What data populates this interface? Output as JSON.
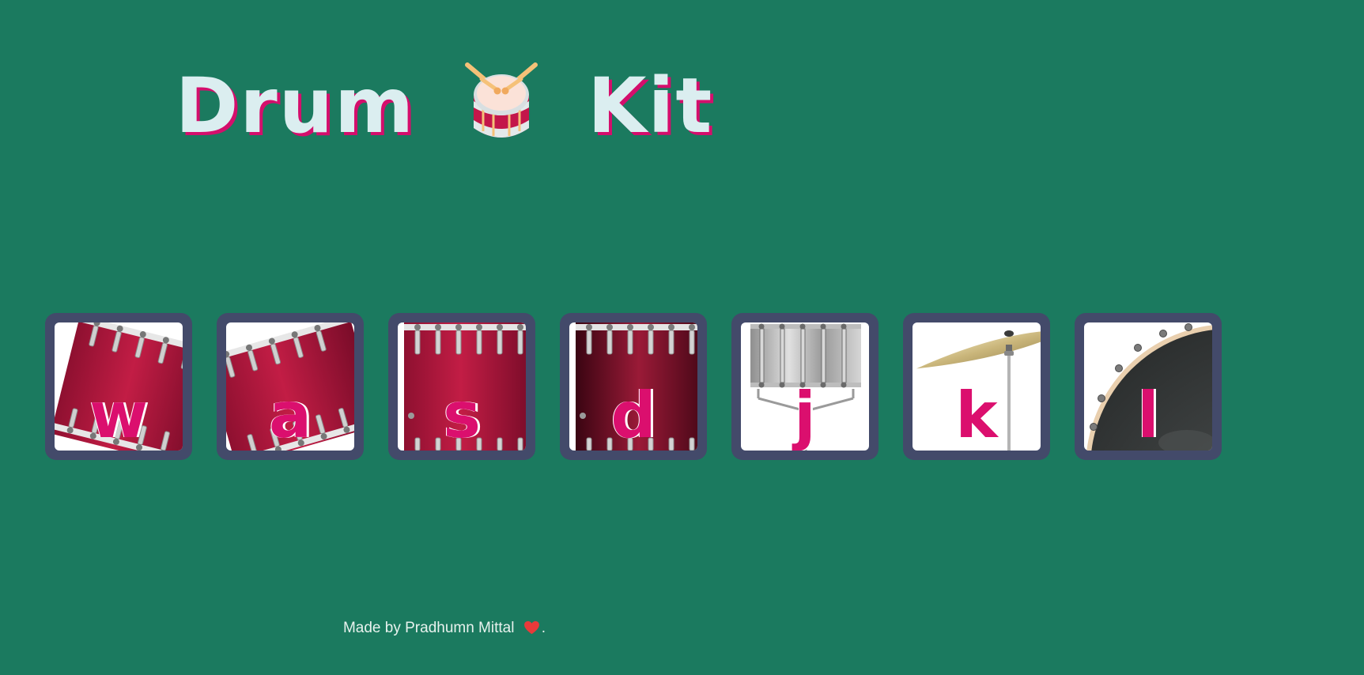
{
  "page": {
    "title_left": "Drum",
    "title_right": "Kit",
    "title_icon": "drum-with-sticks-icon"
  },
  "drums": [
    {
      "key": "w",
      "instrument_icon": "tom-drum-icon"
    },
    {
      "key": "a",
      "instrument_icon": "tom-drum-icon"
    },
    {
      "key": "s",
      "instrument_icon": "floor-drum-icon"
    },
    {
      "key": "d",
      "instrument_icon": "floor-drum-icon"
    },
    {
      "key": "j",
      "instrument_icon": "snare-drum-icon"
    },
    {
      "key": "k",
      "instrument_icon": "cymbal-icon"
    },
    {
      "key": "l",
      "instrument_icon": "bass-drum-icon"
    }
  ],
  "footer": {
    "text": "Made by Pradhumn Mittal",
    "heart_icon": "heart-icon",
    "suffix": "."
  },
  "colors": {
    "background": "#1b7a5f",
    "title_text": "#dbeef0",
    "title_shadow": "#d40e6c",
    "key_letter": "#db0f6e",
    "button_border": "#434a6a",
    "heart": "#e83a3a"
  }
}
